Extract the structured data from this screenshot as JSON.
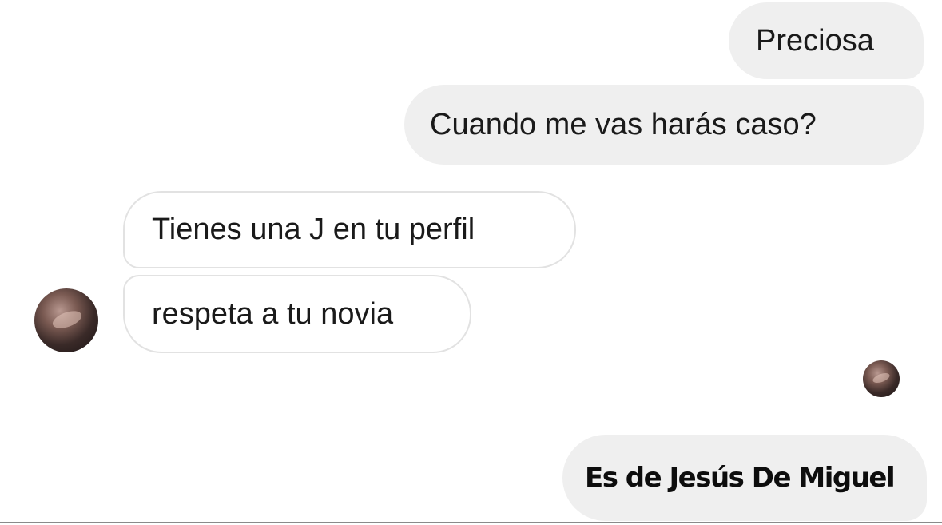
{
  "messages": [
    {
      "text": "Preciosa",
      "direction": "sent"
    },
    {
      "text": "Cuando me vas harás caso?",
      "direction": "sent"
    },
    {
      "text": "Tienes una J en tu perfil",
      "direction": "received"
    },
    {
      "text": "respeta a tu novia",
      "direction": "received"
    },
    {
      "text": "Es de Jesús De Miguel",
      "direction": "sent"
    }
  ],
  "colors": {
    "sent_bubble": "#efefef",
    "received_border": "#e2e2e2",
    "text": "#1a1a1a"
  },
  "icons": {
    "contact_avatar": "avatar-photo",
    "seen_avatar": "seen-indicator-avatar"
  }
}
